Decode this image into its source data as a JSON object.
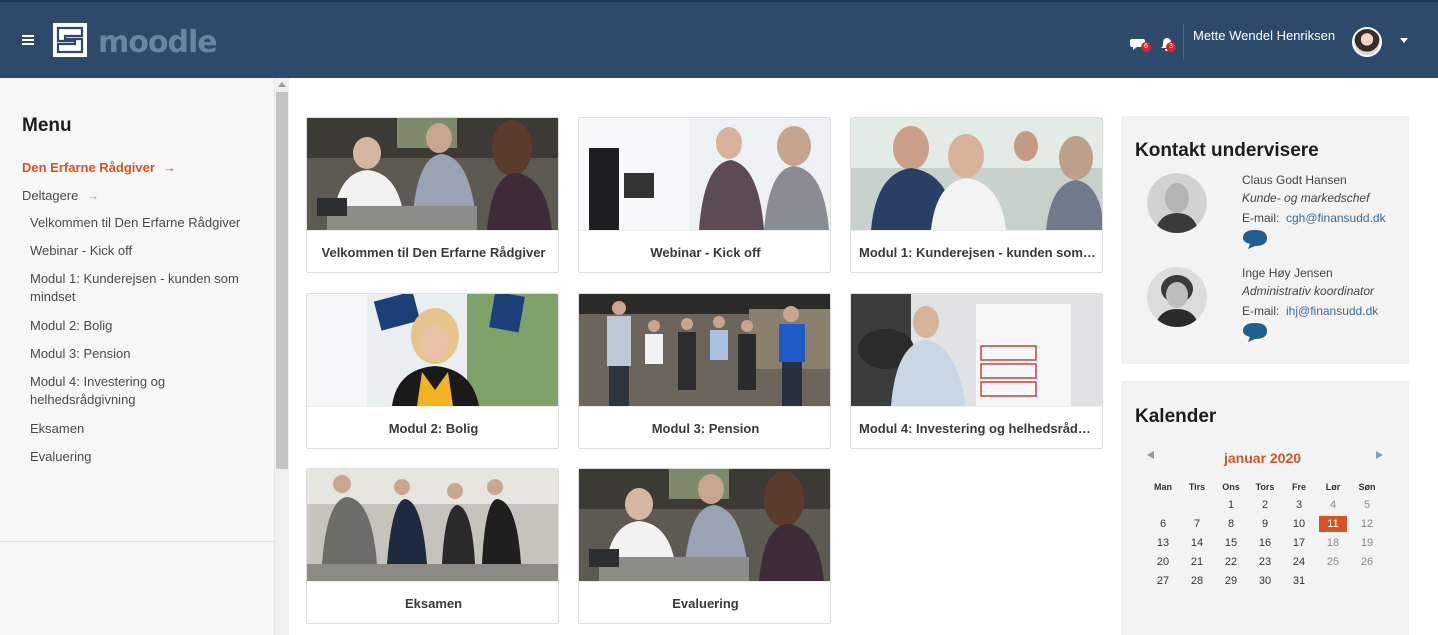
{
  "header": {
    "site_name": "moodle",
    "menu_icon": "hamburger-icon",
    "messages_icon": "chat-bubble-icon",
    "messages_count": "6",
    "notifications_icon": "bell-icon",
    "notifications_count": "3",
    "user_name": "Mette Wendel Henriksen",
    "colors": {
      "topbar": "#2d4a6b",
      "badge": "#d9232e"
    }
  },
  "sidebar": {
    "title": "Menu",
    "items": [
      {
        "label": "Den Erfarne Rådgiver",
        "active": true
      },
      {
        "label": "Deltagere"
      },
      {
        "label": "Velkommen til Den Erfarne Rådgiver"
      },
      {
        "label": "Webinar - Kick off"
      },
      {
        "label": "Modul 1: Kunderejsen - kunden som",
        "label2": "mindset"
      },
      {
        "label": "Modul 2: Bolig"
      },
      {
        "label": "Modul 3: Pension"
      },
      {
        "label": "Modul 4: Investering og",
        "label2": "helhedsrådgivning"
      },
      {
        "label": "Eksamen"
      },
      {
        "label": "Evaluering"
      }
    ],
    "accent_color": "#d45522"
  },
  "courses": [
    {
      "title": "Velkommen til Den Erfarne Rådgiver",
      "photo": "meeting-photo"
    },
    {
      "title": "Webinar - Kick off",
      "photo": "webinar-photo"
    },
    {
      "title": "Modul 1: Kunderejsen - kunden som m...",
      "photo": "group-photo"
    },
    {
      "title": "Modul 2: Bolig",
      "photo": "presenter-photo"
    },
    {
      "title": "Modul 3: Pension",
      "photo": "standing-group-photo"
    },
    {
      "title": "Modul 4: Investering og helhedsrådgiv...",
      "photo": "whiteboard-photo"
    },
    {
      "title": "Eksamen",
      "photo": "seminar-photo"
    },
    {
      "title": "Evaluering",
      "photo": "meeting-photo"
    }
  ],
  "contacts": {
    "title": "Kontakt undervisere",
    "people": [
      {
        "name": "Claus Godt Hansen",
        "role": "Kunde- og markedschef",
        "email_label": "E-mail:",
        "email": "cgh@finansudd.dk"
      },
      {
        "name": "Inge Høy Jensen",
        "role": "Administrativ koordinator",
        "email_label": "E-mail:",
        "email": "ihj@finansudd.dk"
      }
    ]
  },
  "calendar": {
    "title": "Kalender",
    "month": "januar 2020",
    "weekdays": [
      "Man",
      "Tirs",
      "Ons",
      "Tors",
      "Fre",
      "Lør",
      "Søn"
    ],
    "weeks": [
      [
        "",
        "",
        "1",
        "2",
        "3",
        "4",
        "5"
      ],
      [
        "6",
        "7",
        "8",
        "9",
        "10",
        "11",
        "12"
      ],
      [
        "13",
        "14",
        "15",
        "16",
        "17",
        "18",
        "19"
      ],
      [
        "20",
        "21",
        "22",
        "23",
        "24",
        "25",
        "26"
      ],
      [
        "27",
        "28",
        "29",
        "30",
        "31",
        "",
        ""
      ]
    ],
    "today": "11",
    "today_color": "#d45522"
  }
}
